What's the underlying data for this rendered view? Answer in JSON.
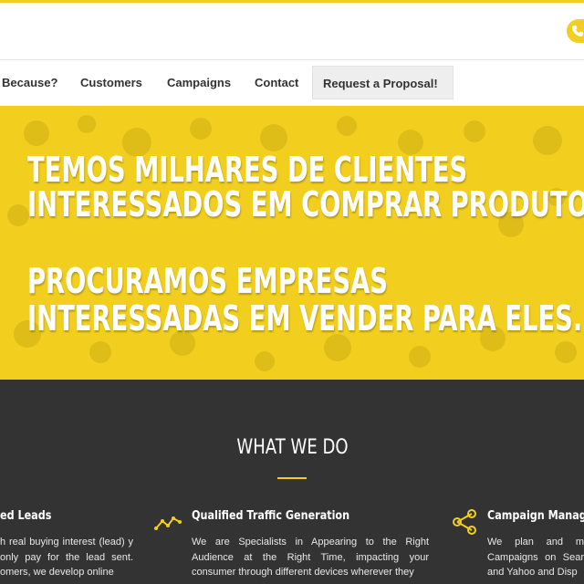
{
  "nav": {
    "items": [
      {
        "label": "Because?"
      },
      {
        "label": "Customers"
      },
      {
        "label": "Campaigns"
      },
      {
        "label": "Contact"
      }
    ],
    "cta_label": "Request a Proposal!"
  },
  "hero": {
    "lines": [
      "TEMOS MILHARES DE CLIENTES",
      "INTERESSADOS EM COMPRAR PRODUTOS",
      "PROCURAMOS EMPRESAS",
      "INTERESSADAS EM VENDER PARA ELES."
    ]
  },
  "what_we_do": {
    "title": "WHAT WE DO",
    "services": [
      {
        "title": "ed Leads",
        "icon": "leads-icon",
        "text": "h real buying interest (lead) y only pay for the lead sent. omers, we develop online"
      },
      {
        "title": "Qualified Traffic Generation",
        "icon": "trend-line-icon",
        "text": "We are Specialists in Appearing to the Right Audience at the Right Time, impacting your consumer through different devices wherever they"
      },
      {
        "title": "Campaign Managem",
        "icon": "share-nodes-icon",
        "text": "We plan and m Campaigns on Sear and Yahoo and Disp"
      }
    ]
  },
  "colors": {
    "accent": "#f2cf1f",
    "dark_section": "#333333",
    "nav_text": "#333333"
  }
}
